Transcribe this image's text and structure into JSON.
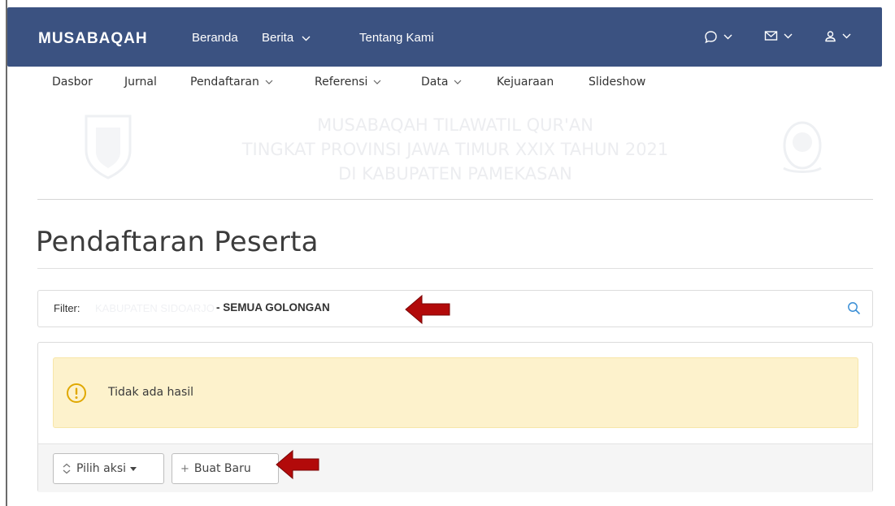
{
  "navbar": {
    "brand": "MUSABAQAH",
    "links": [
      {
        "label": "Beranda"
      },
      {
        "label": "Berita"
      },
      {
        "label": "Tentang Kami"
      }
    ],
    "right_icons": [
      "chat-icon",
      "mail-icon",
      "user-icon"
    ]
  },
  "submenu": {
    "items": [
      {
        "label": "Dasbor"
      },
      {
        "label": "Jurnal"
      },
      {
        "label": "Pendaftaran"
      },
      {
        "label": "Referensi"
      },
      {
        "label": "Data"
      },
      {
        "label": "Kejuaraan"
      },
      {
        "label": "Slideshow"
      }
    ]
  },
  "banner": {
    "line1": "MUSABAQAH TILAWATIL QUR'AN",
    "line2": "TINGKAT PROVINSI JAWA TIMUR XXIX TAHUN 2021",
    "line3": "DI KABUPATEN PAMEKASAN"
  },
  "page": {
    "title": "Pendaftaran Peserta"
  },
  "filter": {
    "label": "Filter:",
    "region": "KABUPATEN SIDOARJO",
    "group": "- SEMUA GOLONGAN"
  },
  "results": {
    "empty_message": "Tidak ada hasil"
  },
  "actions": {
    "choose_action": "Pilih aksi",
    "create_new": "Buat Baru"
  },
  "colors": {
    "navbar": "#3b5281",
    "alert_bg": "#fdf2cc",
    "alert_icon": "#e0a800",
    "arrow": "#b20a0a",
    "search_icon": "#3b8fd6"
  }
}
